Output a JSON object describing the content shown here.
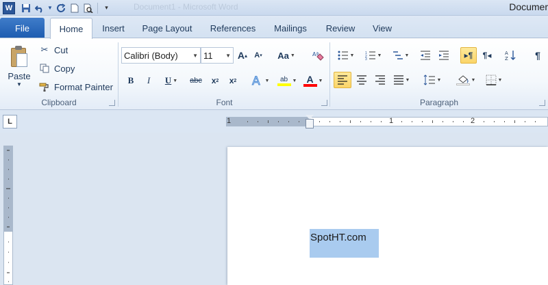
{
  "window": {
    "app_icon_letter": "W",
    "title": "Document1 - Microsoft Word",
    "title_clipped": "Documer"
  },
  "tabs": [
    {
      "label": "File"
    },
    {
      "label": "Home"
    },
    {
      "label": "Insert"
    },
    {
      "label": "Page Layout"
    },
    {
      "label": "References"
    },
    {
      "label": "Mailings"
    },
    {
      "label": "Review"
    },
    {
      "label": "View"
    }
  ],
  "clipboard": {
    "paste_label": "Paste",
    "cut_label": "Cut",
    "copy_label": "Copy",
    "format_painter_label": "Format Painter",
    "group_label": "Clipboard"
  },
  "font": {
    "font_name": "Calibri (Body)",
    "font_size": "11",
    "group_label": "Font",
    "highlight_color": "#ffff00",
    "font_color": "#ff0000"
  },
  "paragraph": {
    "group_label": "Paragraph"
  },
  "ruler": {
    "tab_selector": "L",
    "numbers": [
      "1",
      "1",
      "2"
    ]
  },
  "document": {
    "selected_text": "SpotHT.com"
  },
  "colors": {
    "file_tab": "#2a5fb5",
    "selection": "#a9cbef",
    "active_toggle": "#fbd569"
  }
}
